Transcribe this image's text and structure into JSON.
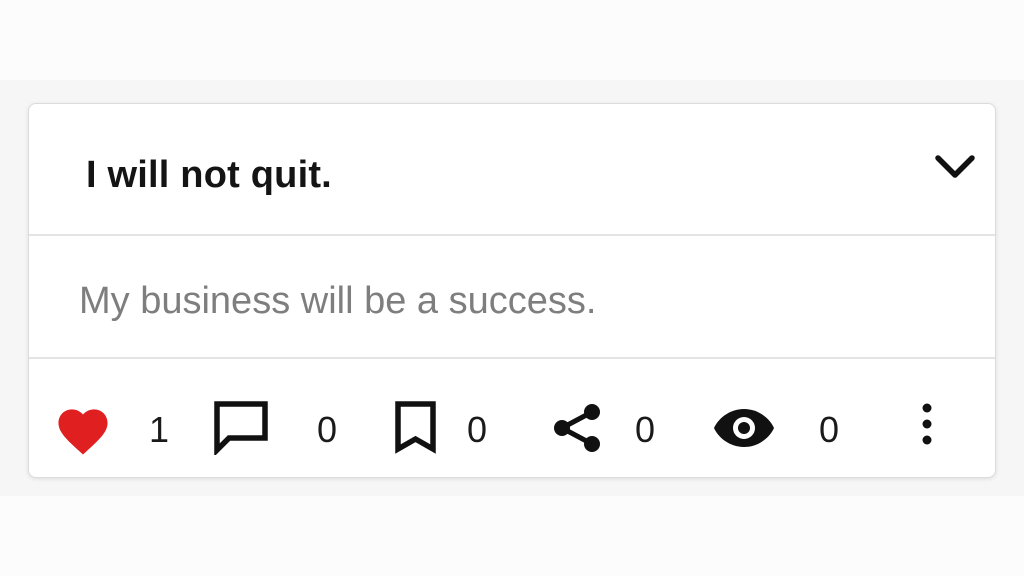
{
  "card": {
    "title": "I will not quit.",
    "subtitle": "My business will be a success."
  },
  "actions": {
    "like": {
      "icon": "heart-icon",
      "count": "1",
      "color": "#e02020"
    },
    "comment": {
      "icon": "comment-icon",
      "count": "0"
    },
    "bookmark": {
      "icon": "bookmark-icon",
      "count": "0"
    },
    "share": {
      "icon": "share-icon",
      "count": "0"
    },
    "views": {
      "icon": "eye-icon",
      "count": "0"
    },
    "more": {
      "icon": "more-vertical-icon"
    }
  },
  "colors": {
    "accent_like": "#e02020",
    "text_primary": "#141414",
    "text_secondary": "#7e7e7e",
    "divider": "#e4e4e4"
  }
}
